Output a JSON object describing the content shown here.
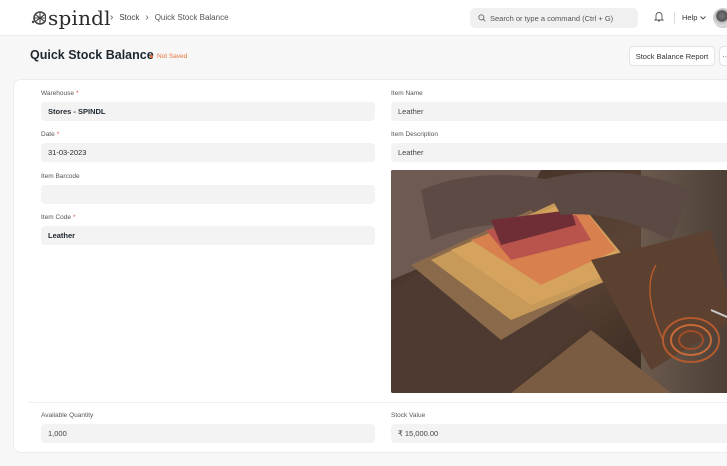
{
  "app": {
    "logo_text": "spindl"
  },
  "breadcrumb": {
    "items": [
      "Stock",
      "Quick Stock Balance"
    ]
  },
  "search": {
    "placeholder": "Search or type a command (Ctrl + G)"
  },
  "navbar": {
    "help_label": "Help"
  },
  "page": {
    "title": "Quick Stock Balance",
    "status": "Not Saved",
    "report_button": "Stock Balance Report",
    "more_button": "···"
  },
  "form": {
    "warehouse": {
      "label": "Warehouse",
      "required": "*",
      "value": "Stores - SPINDL"
    },
    "date": {
      "label": "Date",
      "required": "*",
      "value": "31-03-2023"
    },
    "item_barcode": {
      "label": "Item Barcode",
      "value": ""
    },
    "item_code": {
      "label": "Item Code",
      "required": "*",
      "value": "Leather"
    },
    "item_name": {
      "label": "Item Name",
      "value": "Leather"
    },
    "item_description": {
      "label": "Item Description",
      "value": "Leather"
    },
    "available_quantity": {
      "label": "Available Quantity",
      "value": "1,000"
    },
    "stock_value": {
      "label": "Stock Value",
      "value": "₹ 15,000.00"
    }
  },
  "colors": {
    "accent_orange": "#e8743b",
    "required_red": "#e24c4c",
    "field_bg": "#f3f3f3"
  },
  "icons": [
    "spindl-logo-icon",
    "chevron-right-icon",
    "search-icon",
    "bell-icon",
    "chevron-down-icon",
    "avatar"
  ]
}
